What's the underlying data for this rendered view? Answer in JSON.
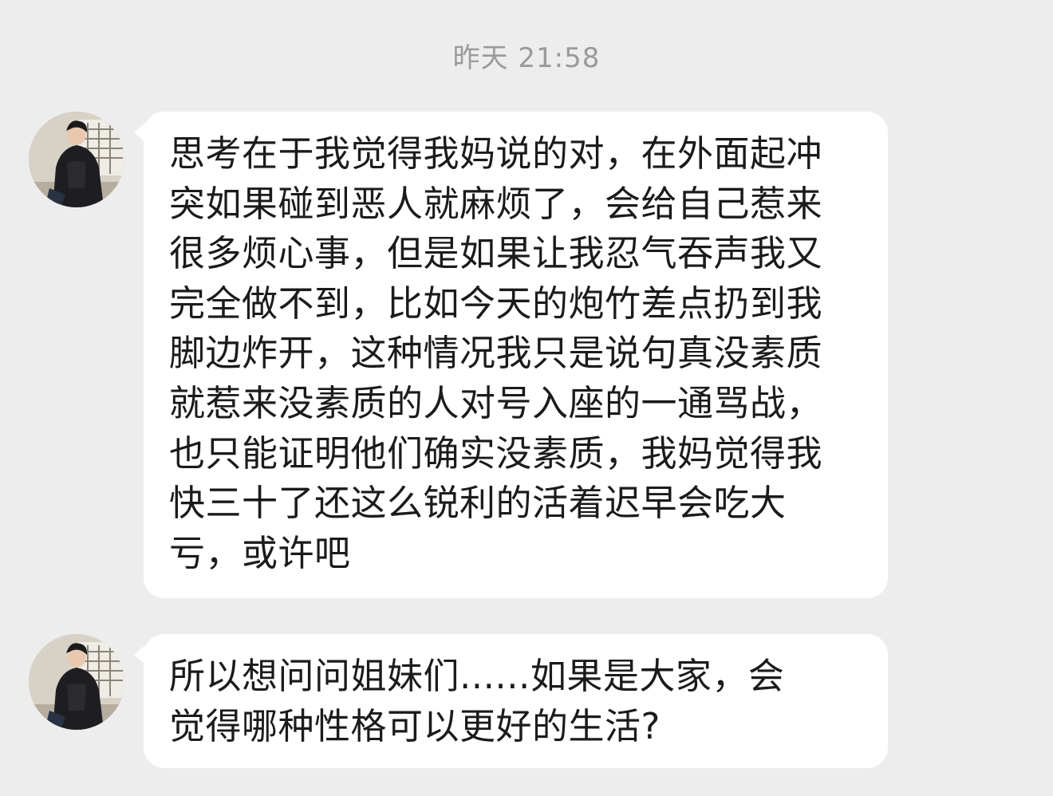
{
  "chat": {
    "timestamp": "昨天 21:58",
    "messages": [
      {
        "sender_avatar": "user-avatar-photo",
        "text": "思考在于我觉得我妈说的对，在外面起冲突如果碰到恶人就麻烦了，会给自己惹来很多烦心事，但是如果让我忍气吞声我又完全做不到，比如今天的炮竹差点扔到我脚边炸开，这种情况我只是说句真没素质就惹来没素质的人对号入座的一通骂战，也只能证明他们确实没素质，我妈觉得我快三十了还这么锐利的活着迟早会吃大亏，或许吧"
      },
      {
        "sender_avatar": "user-avatar-photo",
        "text": "所以想问问姐妹们......如果是大家，会觉得哪种性格可以更好的生活?"
      }
    ]
  },
  "colors": {
    "background": "#ededed",
    "bubble": "#ffffff",
    "text": "#1b1b1b",
    "timestamp": "#9a9a9a"
  }
}
